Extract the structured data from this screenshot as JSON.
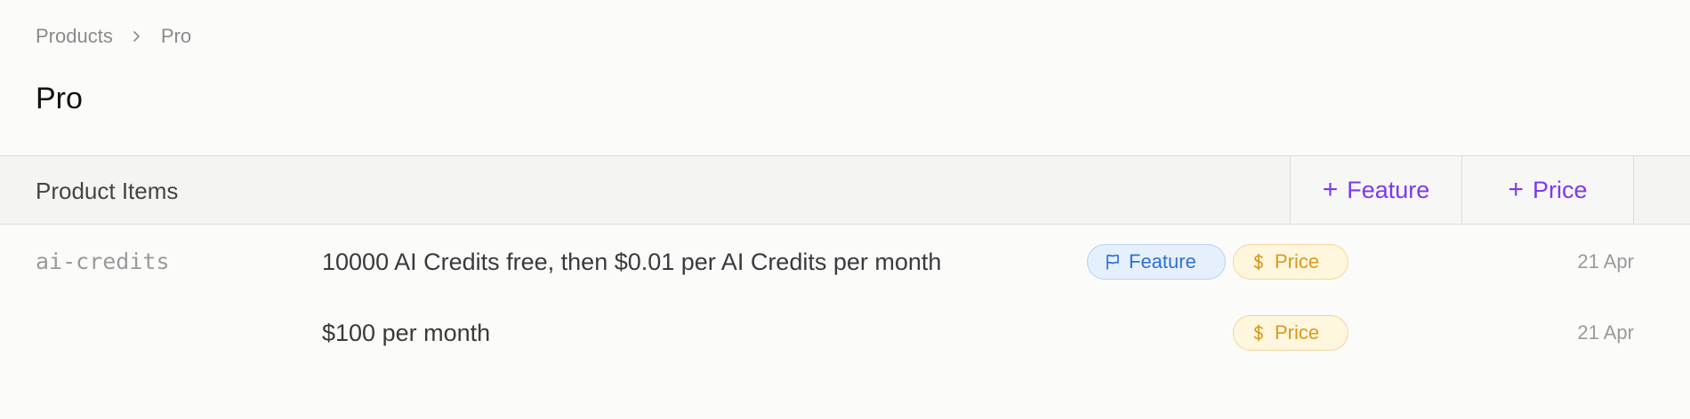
{
  "breadcrumb": {
    "parent": "Products",
    "current": "Pro"
  },
  "page": {
    "title": "Pro"
  },
  "section": {
    "title": "Product Items",
    "add_feature_label": "Feature",
    "add_price_label": "Price"
  },
  "items": [
    {
      "id": "ai-credits",
      "description": "10000 AI Credits free, then $0.01 per AI Credits per month",
      "badges": {
        "feature": "Feature",
        "price": "Price"
      },
      "date": "21 Apr"
    },
    {
      "id": "",
      "description": "$100 per month",
      "badges": {
        "price": "Price"
      },
      "date": "21 Apr"
    }
  ],
  "colors": {
    "accent": "#7c3aed",
    "feature_badge": "#2f6fd8",
    "price_badge": "#d99a1e"
  },
  "icons": {
    "breadcrumb_separator": "chevron-right-icon",
    "feature": "flag-icon",
    "price": "dollar-icon",
    "add": "plus-icon"
  }
}
